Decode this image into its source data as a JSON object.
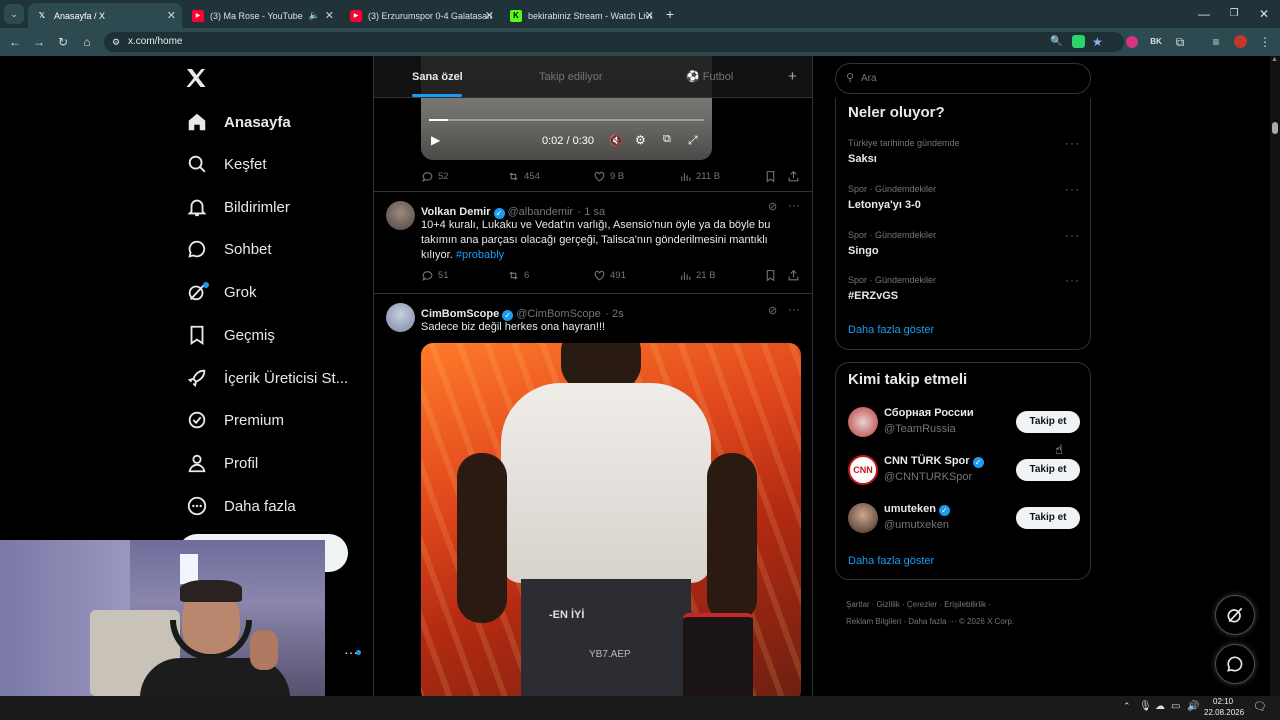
{
  "browser": {
    "tabs": [
      {
        "title": "Anasayfa / X",
        "icon": "x-logo-icon"
      },
      {
        "title": "(3) Ma Rose - YouTube",
        "icon": "youtube-icon"
      },
      {
        "title": "(3) Erzurumspor 0-4 Galatasara",
        "icon": "youtube-icon"
      },
      {
        "title": "bekirabiniz Stream - Watch Live",
        "icon": "kick-icon"
      }
    ],
    "new_tab": "+",
    "url": "x.com/home"
  },
  "sidebar": {
    "logo": "X",
    "items": [
      {
        "label": "Anasayfa",
        "icon": "home-icon"
      },
      {
        "label": "Keşfet",
        "icon": "search-icon"
      },
      {
        "label": "Bildirimler",
        "icon": "bell-icon"
      },
      {
        "label": "Sohbet",
        "icon": "chat-icon"
      },
      {
        "label": "Grok",
        "icon": "grok-icon"
      },
      {
        "label": "Geçmiş",
        "icon": "bookmark-icon"
      },
      {
        "label": "İçerik Üreticisi St...",
        "icon": "rocket-icon"
      },
      {
        "label": "Premium",
        "icon": "verified-icon"
      },
      {
        "label": "Profil",
        "icon": "person-icon"
      },
      {
        "label": "Daha fazla",
        "icon": "more-circle-icon"
      }
    ]
  },
  "feed": {
    "tabs": [
      "Sana özel",
      "Takip ediliyor",
      "Futbol"
    ],
    "add_tab": "+",
    "video": {
      "time": "0:02 / 0:30",
      "progress": 0.07
    },
    "first_metrics": {
      "replies": "52",
      "reposts": "454",
      "likes": "9 B",
      "views": "211 B"
    },
    "tweets": [
      {
        "name": "Volkan Demir",
        "handle": "@albandemir",
        "time": "· 1 sa",
        "text": "10+4 kuralı, Lukaku ve Vedat'ın varlığı, Asensio'nun öyle ya da böyle bu takımın ana parçası olacağı gerçeği, Talisca'nın gönderilmesini mantıklı kılıyor.",
        "hashtag": "#probably",
        "replies": "51",
        "reposts": "6",
        "likes": "491",
        "views": "21 B"
      },
      {
        "name": "CimBomScope",
        "handle": "@CimBomScope",
        "time": "· 2s",
        "text": "Sadece biz değil herkes ona hayran!!!",
        "image_text": "-EN İYİ",
        "image_text2": "YB7.AEP"
      }
    ]
  },
  "right": {
    "search_placeholder": "Ara",
    "trends_title": "Neler oluyor?",
    "trends": [
      {
        "category": "Türkiye tarihinde gündemde",
        "title": "Saksı"
      },
      {
        "category": "Spor · Gündemdekiler",
        "title": "Letonya'yı 3-0"
      },
      {
        "category": "Spor · Gündemdekiler",
        "title": "Singo"
      },
      {
        "category": "Spor · Gündemdekiler",
        "title": "#ERZvGS"
      }
    ],
    "trends_more": "Daha fazla göster",
    "follow_title": "Kimi takip etmeli",
    "follow": [
      {
        "name": "Сборная России",
        "handle": "@TeamRussia",
        "verified": false,
        "button": "Takip et"
      },
      {
        "name": "CNN TÜRK Spor",
        "handle": "@CNNTURKSpor",
        "verified": true,
        "button": "Takip et"
      },
      {
        "name": "umuteken",
        "handle": "@umutxeken",
        "verified": true,
        "button": "Takip et"
      }
    ],
    "follow_more": "Daha fazla göster",
    "footer_links": [
      "Şartlar",
      "Gizlilik",
      "Çerezler",
      "Erişilebilirlik",
      "Reklam Bilgileri",
      "Daha fazla ···"
    ],
    "copyright": "© 2026 X Corp."
  },
  "taskbar": {
    "time": "02:10",
    "date": "22.08.2026"
  },
  "colors": {
    "accent": "#1d9bf0",
    "background": "#000000",
    "border": "#2f3336",
    "muted": "#71767b",
    "tab_bar": "#1f3338"
  }
}
